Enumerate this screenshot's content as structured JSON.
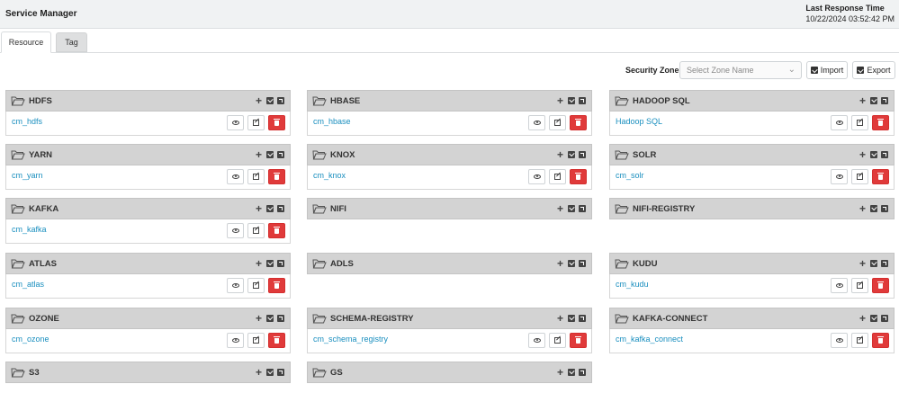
{
  "header": {
    "title": "Service Manager",
    "last_response_label": "Last Response Time",
    "last_response_value": "10/22/2024 03:52:42 PM"
  },
  "tabs": [
    {
      "label": "Resource",
      "active": true
    },
    {
      "label": "Tag",
      "active": false
    }
  ],
  "toolbar": {
    "zone_label": "Security Zone :",
    "zone_placeholder": "Select Zone Name",
    "import_label": "Import",
    "export_label": "Export"
  },
  "services": {
    "hdfs": {
      "name": "HDFS",
      "instance": "cm_hdfs"
    },
    "hbase": {
      "name": "HBASE",
      "instance": "cm_hbase"
    },
    "hadoop_sql": {
      "name": "HADOOP SQL",
      "instance": "Hadoop SQL"
    },
    "yarn": {
      "name": "YARN",
      "instance": "cm_yarn"
    },
    "knox": {
      "name": "KNOX",
      "instance": "cm_knox"
    },
    "solr": {
      "name": "SOLR",
      "instance": "cm_solr"
    },
    "kafka": {
      "name": "KAFKA",
      "instance": "cm_kafka"
    },
    "nifi": {
      "name": "NIFI"
    },
    "nifi_registry": {
      "name": "NIFI-REGISTRY"
    },
    "atlas": {
      "name": "ATLAS",
      "instance": "cm_atlas"
    },
    "adls": {
      "name": "ADLS"
    },
    "kudu": {
      "name": "KUDU",
      "instance": "cm_kudu"
    },
    "ozone": {
      "name": "OZONE",
      "instance": "cm_ozone"
    },
    "schema_registry": {
      "name": "SCHEMA-REGISTRY",
      "instance": "cm_schema_registry"
    },
    "kafka_connect": {
      "name": "KAFKA-CONNECT",
      "instance": "cm_kafka_connect"
    },
    "s3": {
      "name": "S3"
    },
    "gs": {
      "name": "GS"
    }
  },
  "icons": {
    "folder": "folder-open-icon",
    "add": "plus-icon",
    "enable": "check-square-icon",
    "export": "external-square-icon",
    "view": "eye-icon",
    "edit": "edit-icon",
    "delete": "trash-icon"
  },
  "colors": {
    "link": "#1a8fbf",
    "delete": "#e03a3a",
    "header_bg": "#d3d3d3"
  }
}
